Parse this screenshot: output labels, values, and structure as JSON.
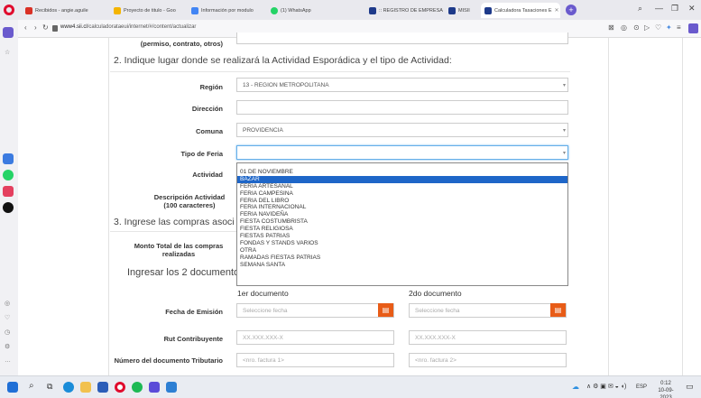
{
  "browser": {
    "tabs": [
      {
        "label": "Recibidos - angie.aguile",
        "color": "#d93025"
      },
      {
        "label": "Proyecto de titulo - Goo",
        "color": "#f4b400"
      },
      {
        "label": "Información por modulo",
        "color": "#4285f4"
      },
      {
        "label": "(1) WhatsApp",
        "color": "#25d366"
      },
      {
        "label": ":: REGISTRO DE EMPRESA",
        "color": "#1e3a8a"
      },
      {
        "label": "MISII",
        "color": "#1e3a8a"
      },
      {
        "label": "Calculadora Tasaciones E",
        "color": "#1e3a8a"
      }
    ],
    "url_domain": "www4.sii.cl",
    "url_path": "/calculadorataeui/internet/#/content/actualizar"
  },
  "form": {
    "top_label": "(permiso, contrato, otros)",
    "section2_title": "2. Indique lugar donde se realizará la Actividad Esporádica y el tipo de Actividad:",
    "region_label": "Región",
    "region_value": "13 - REGION METROPOLITANA",
    "direccion_label": "Dirección",
    "direccion_value": "",
    "comuna_label": "Comuna",
    "comuna_value": "PROVIDENCIA",
    "tipo_feria_label": "Tipo de Feria",
    "tipo_feria_value": "",
    "actividad_label": "Actividad",
    "descripcion_label_1": "Descripción Actividad",
    "descripcion_label_2": "(100 caracteres)",
    "section3_title": "3. Ingrese las compras asoci",
    "monto_label_1": "Monto Total de las compras",
    "monto_label_2": "realizadas",
    "docs_title": "Ingresar los 2 documento",
    "doc1_header": "1er documento",
    "doc2_header": "2do documento",
    "fecha_label": "Fecha de Emisión",
    "fecha_placeholder": "Seleccione fecha",
    "rut_label": "Rut Contribuyente",
    "rut_placeholder": "XX.XXX.XXX-X",
    "nro_label": "Número del documento Tributario",
    "nro1_placeholder": "<nro. factura 1>",
    "nro2_placeholder": "<nro. factura 2>"
  },
  "dropdown": {
    "options": [
      "01 DE NOVIEMBRE",
      "BAZAR",
      "FERIA ARTESANAL",
      "FERIA CAMPESINA",
      "FERIA DEL LIBRO",
      "FERIA INTERNACIONAL",
      "FERIA NAVIDEÑA",
      "FIESTA COSTUMBRISTA",
      "FIESTA RELIGIOSA",
      "FIESTAS PATRIAS",
      "FONDAS Y STANDS VARIOS",
      "OTRA",
      "RAMADAS FIESTAS PATRIAS",
      "SEMANA SANTA"
    ],
    "selected": "BAZAR"
  },
  "taskbar": {
    "lang": "ESP",
    "time": "0:12",
    "date": "10-09-2023"
  },
  "colors": {
    "accent_orange": "#e85c17",
    "select_blue": "#1e66c8",
    "opera_red": "#e00b2d"
  }
}
